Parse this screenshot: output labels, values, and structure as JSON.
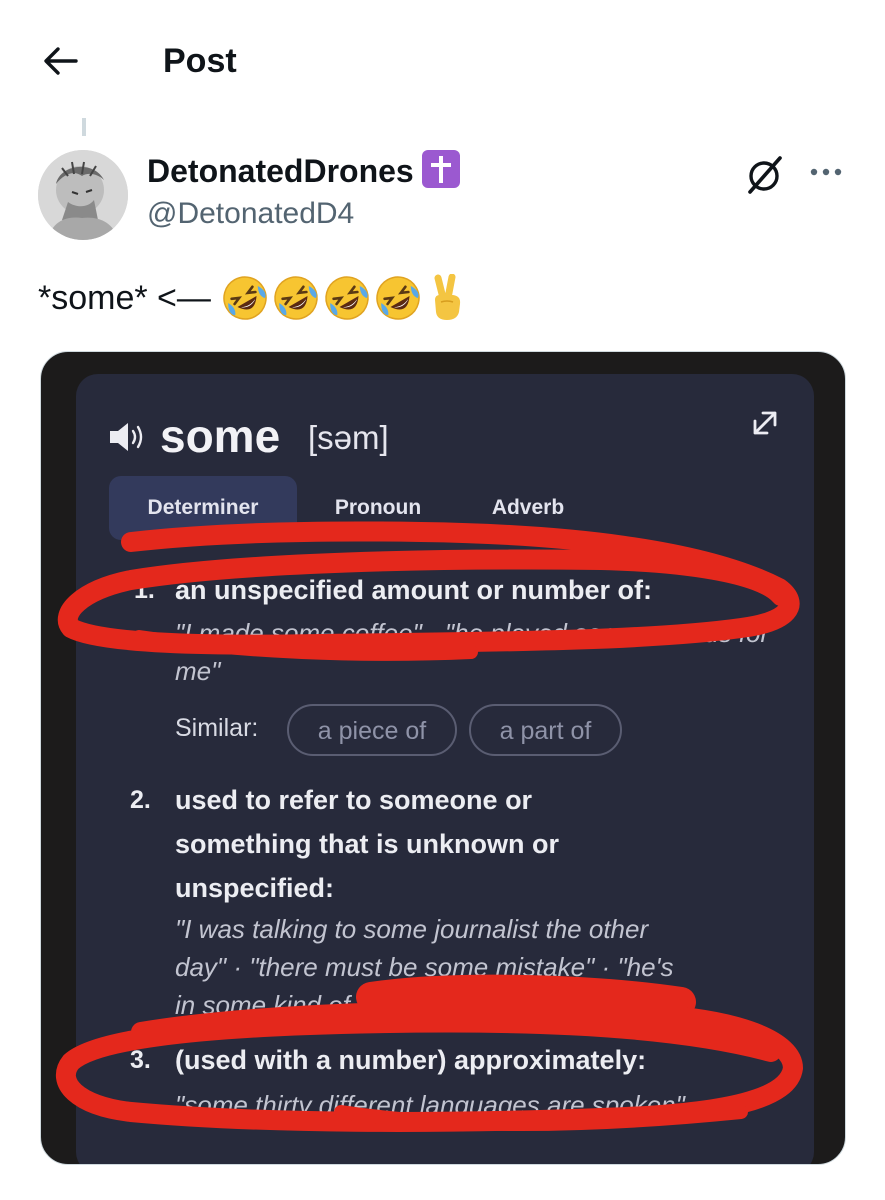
{
  "header": {
    "title": "Post",
    "back_icon": "arrow-left-icon"
  },
  "post": {
    "display_name": "DetonatedDrones",
    "handle": "@DetonatedD4",
    "badge_icon": "latin-cross-icon",
    "text": "*some* <—",
    "emojis": [
      "rolling-on-floor-laughing",
      "rolling-on-floor-laughing",
      "rolling-on-floor-laughing",
      "rolling-on-floor-laughing",
      "victory-hand"
    ]
  },
  "dictionary_image": {
    "word": "some",
    "phonetic": "[səm]",
    "tabs": [
      {
        "label": "Determiner",
        "active": true
      },
      {
        "label": "Pronoun",
        "active": false
      },
      {
        "label": "Adverb",
        "active": false
      }
    ],
    "definitions": [
      {
        "number": "1.",
        "text": "an unspecified amount or number of:",
        "example": "\"I made some coffee\" · \"he played some records for me\""
      },
      {
        "number": "2.",
        "text_lines": [
          "used to refer to someone or",
          "something that is unknown or",
          "unspecified:"
        ],
        "example_lines": [
          "\"I was talking to some journalist the other",
          "day\" · \"there must be some mistake\" · \"he's",
          "in some kind of trouble\""
        ]
      },
      {
        "number": "3.",
        "text": "(used with a number) approximately:",
        "example": "\"some thirty different languages are spoken\""
      }
    ],
    "similar_label": "Similar:",
    "similar_chips": [
      "a piece of",
      "a part of"
    ],
    "annotation_color": "#e4281c"
  },
  "colors": {
    "card_bg": "#272a3b",
    "tab_active": "#333a5c",
    "handle_gray": "#536471"
  }
}
